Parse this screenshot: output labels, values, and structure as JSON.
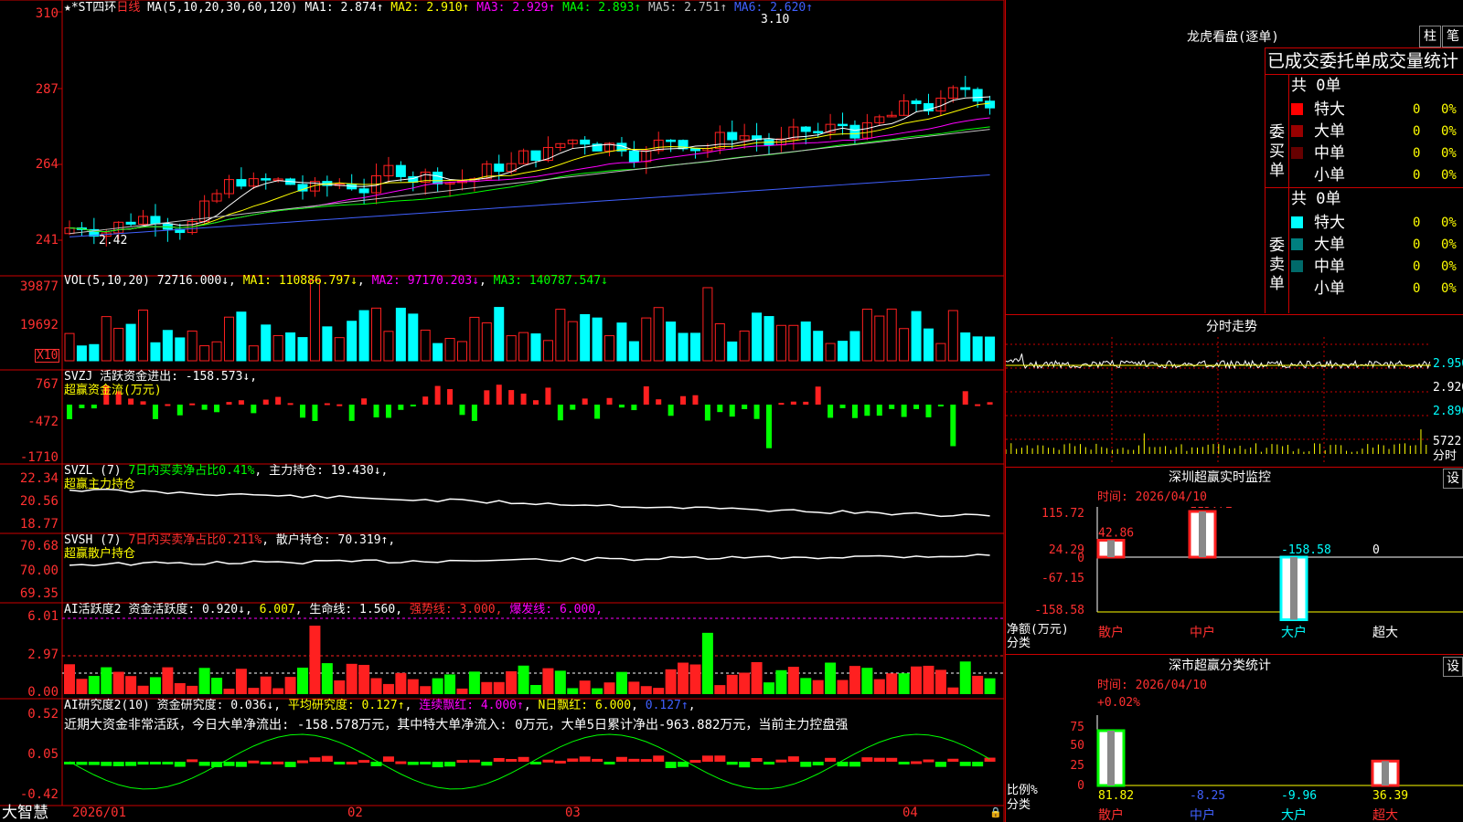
{
  "colors": {
    "up": "#ff2020",
    "down": "#00ffff",
    "grid": "#cc0000",
    "axis_text": "#ff3030"
  },
  "main_chart": {
    "title": "★*ST四环",
    "period": "日线",
    "ma_label": "MA(5,10,20,30,60,120)",
    "ma_values": [
      {
        "text": "MA1: 2.874↑",
        "color": "#ffffff"
      },
      {
        "text": "MA2: 2.910↑",
        "color": "#ffff00"
      },
      {
        "text": "MA3: 2.929↑",
        "color": "#ff00ff"
      },
      {
        "text": "MA4: 2.893↑",
        "color": "#00ff00"
      },
      {
        "text": "MA5: 2.751↑",
        "color": "#c0c0c0"
      },
      {
        "text": "MA6: 2.620↑",
        "color": "#4060ff"
      }
    ],
    "y_ticks": [
      "310",
      "287",
      "264",
      "241"
    ],
    "high_label": "3.10",
    "low_label": "2.42"
  },
  "vol_panel": {
    "label": "VOL(5,10,20)",
    "value": "72716.000↓",
    "ma_values": [
      {
        "text": "MA1: 110886.797↓",
        "color": "#ffff00"
      },
      {
        "text": "MA2: 97170.203↓",
        "color": "#ff00ff"
      },
      {
        "text": "MA3: 140787.547↓",
        "color": "#00ff00"
      }
    ],
    "y_ticks": [
      "39877",
      "19692"
    ],
    "unit": "X10"
  },
  "svzj_panel": {
    "label": "SVZJ",
    "value": "活跃资金进出: -158.573↓",
    "subtitle": "超赢资金流(万元)",
    "y_ticks": [
      "767",
      "-472",
      "-1710"
    ]
  },
  "svzl_panel": {
    "label": "SVZL (7)",
    "ratio": "7日内买卖净占比0.41%",
    "value": "主力持仓: 19.430↓",
    "subtitle": "超赢主力持仓",
    "y_ticks": [
      "22.34",
      "20.56",
      "18.77"
    ]
  },
  "svsh_panel": {
    "label": "SVSH (7)",
    "ratio": "7日内买卖净占比0.211%",
    "value": "散户持仓: 70.319↑",
    "subtitle": "超赢散户持仓",
    "y_ticks": [
      "70.68",
      "70.00",
      "69.35"
    ]
  },
  "ai_active_panel": {
    "label": "AI活跃度2",
    "values": [
      {
        "text": "资金活跃度: 0.920↓",
        "color": "#ffffff"
      },
      {
        "text": "6.007",
        "color": "#ffff00"
      },
      {
        "text": "生命线: 1.560",
        "color": "#ffffff"
      },
      {
        "text": "强势线: 3.000",
        "color": "#ff3030"
      },
      {
        "text": "爆发线: 6.000",
        "color": "#ff00ff"
      }
    ],
    "y_ticks": [
      "6.01",
      "2.97",
      "0.00"
    ]
  },
  "ai_research_panel": {
    "label": "AI研究度2(10)",
    "values": [
      {
        "text": "资金研究度: 0.036↓",
        "color": "#ffffff"
      },
      {
        "text": "平均研究度: 0.127↑",
        "color": "#ffff00"
      },
      {
        "text": "连续飘红: 4.000↑",
        "color": "#ff00ff"
      },
      {
        "text": "N日飘红: 6.000",
        "color": "#ffff00"
      },
      {
        "text": "0.127↑",
        "color": "#4060ff"
      }
    ],
    "comment": "近期大资金非常活跃，今日大单净流出: -158.578万元，其中特大单净流入: 0万元，大单5日累计净出-963.882万元，当前主力控盘强",
    "y_ticks": [
      "0.52",
      "0.05",
      "-0.42"
    ]
  },
  "x_axis": {
    "labels": [
      "2026/01",
      "02",
      "03",
      "04"
    ]
  },
  "brand": "大智慧",
  "right_panel": {
    "dragon_title": "龙虎看盘(逐单)",
    "tab_zhu": "柱",
    "tab_bi": "笔",
    "header_text": "已成交委托单成交量统计",
    "buy_label": "委买单",
    "sell_label": "委卖单",
    "buy_total": "共 0单",
    "sell_total": "共 0单",
    "buy_rows": [
      {
        "label": "特大",
        "value": "0",
        "pct": "0%",
        "color": "#ff0000"
      },
      {
        "label": "大单",
        "value": "0",
        "pct": "0%",
        "color": "#990000"
      },
      {
        "label": "中单",
        "value": "0",
        "pct": "0%",
        "color": "#660000"
      },
      {
        "label": "小单",
        "value": "0",
        "pct": "0%",
        "color": ""
      }
    ],
    "sell_rows": [
      {
        "label": "特大",
        "value": "0",
        "pct": "0%",
        "color": "#00ffff"
      },
      {
        "label": "大单",
        "value": "0",
        "pct": "0%",
        "color": "#008080"
      },
      {
        "label": "中单",
        "value": "0",
        "pct": "0%",
        "color": "#006a6a"
      },
      {
        "label": "小单",
        "value": "0",
        "pct": "0%",
        "color": ""
      }
    ],
    "intraday_title": "分时走势",
    "intraday_ticks": [
      "2.950",
      "2.920",
      "2.890"
    ],
    "intraday_vol": "5722",
    "intraday_unit": "分时",
    "sz_title": "深圳超赢实时监控",
    "sz_setting": "设",
    "sz_time": "时间: 2026/04/10",
    "sz_y_ticks": [
      "115.72",
      "24.29",
      "0",
      "-67.15",
      "-158.58"
    ],
    "sz_ylabel": "净额(万元)",
    "sz_xlabel": "分类",
    "sz_bars": [
      {
        "cat": "散户",
        "value": "42.86",
        "cat_color": "#ff3030",
        "val_color": "#ff3030"
      },
      {
        "cat": "中户",
        "value": "115.72",
        "cat_color": "#ff3030",
        "val_color": "#ff3030"
      },
      {
        "cat": "大户",
        "value": "-158.58",
        "cat_color": "#00ffff",
        "val_color": "#00ffff"
      },
      {
        "cat": "超大",
        "value": "0",
        "cat_color": "#ffffff",
        "val_color": "#ffffff"
      }
    ],
    "ss_title": "深市超赢分类统计",
    "ss_setting": "设",
    "ss_time": "时间: 2026/04/10",
    "ss_top": "+0.02%",
    "ss_y_ticks": [
      "75",
      "50",
      "25",
      "0"
    ],
    "ss_ylabel": "比例%",
    "ss_xlabel": "分类",
    "ss_bars": [
      {
        "cat": "散户",
        "value": "81.82",
        "cat_color": "#ff3030",
        "val_color": "#ffff00"
      },
      {
        "cat": "中户",
        "value": "-8.25",
        "cat_color": "#4060ff",
        "val_color": "#4060ff"
      },
      {
        "cat": "大户",
        "value": "-9.96",
        "cat_color": "#00ffff",
        "val_color": "#00ffff"
      },
      {
        "cat": "超大",
        "value": "36.39",
        "cat_color": "#ff3030",
        "val_color": "#ffff00"
      }
    ]
  }
}
